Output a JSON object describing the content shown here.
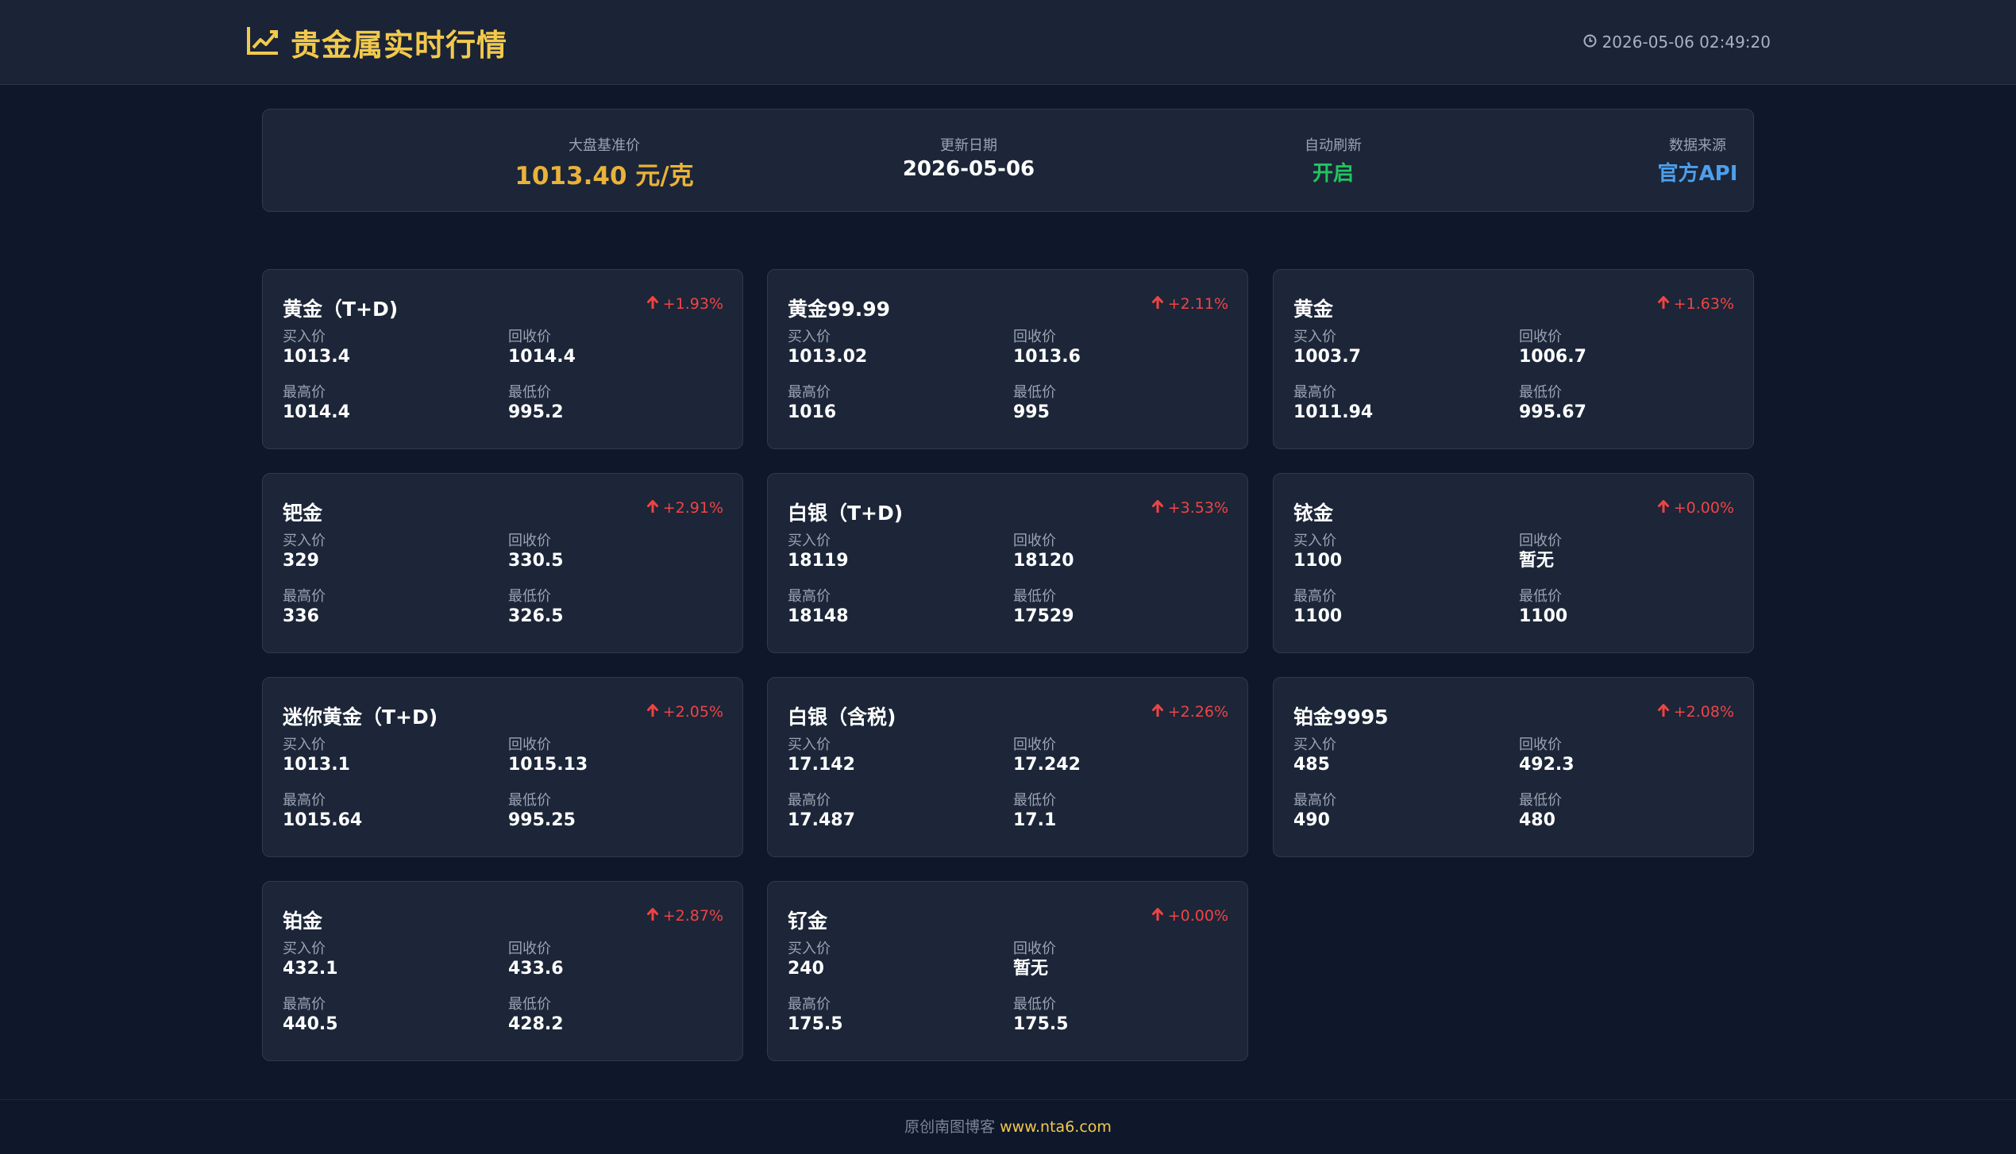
{
  "header": {
    "title": "贵金属实时行情",
    "datetime": "2026-05-06 02:49:20"
  },
  "stats": [
    {
      "label": "大盘基准价",
      "value": "1013.40 元/克",
      "color": "#eab23a"
    },
    {
      "label": "更新日期",
      "value": "2026-05-06",
      "color": "#ffffff"
    },
    {
      "label": "自动刷新",
      "value": "开启",
      "color": "#22c55e"
    },
    {
      "label": "数据来源",
      "value": "官方API",
      "color": "#4d9fec"
    }
  ],
  "field_labels": {
    "buy": "买入价",
    "recycle": "回收价",
    "high": "最高价",
    "low": "最低价"
  },
  "cards": [
    {
      "name": "黄金（T+D)",
      "change": "+1.93%",
      "buy": "1013.4",
      "recycle": "1014.4",
      "high": "1014.4",
      "low": "995.2"
    },
    {
      "name": "黄金99.99",
      "change": "+2.11%",
      "buy": "1013.02",
      "recycle": "1013.6",
      "high": "1016",
      "low": "995"
    },
    {
      "name": "黄金",
      "change": "+1.63%",
      "buy": "1003.7",
      "recycle": "1006.7",
      "high": "1011.94",
      "low": "995.67"
    },
    {
      "name": "钯金",
      "change": "+2.91%",
      "buy": "329",
      "recycle": "330.5",
      "high": "336",
      "low": "326.5"
    },
    {
      "name": "白银（T+D)",
      "change": "+3.53%",
      "buy": "18119",
      "recycle": "18120",
      "high": "18148",
      "low": "17529"
    },
    {
      "name": "铱金",
      "change": "+0.00%",
      "buy": "1100",
      "recycle": "暂无",
      "high": "1100",
      "low": "1100"
    },
    {
      "name": "迷你黄金（T+D)",
      "change": "+2.05%",
      "buy": "1013.1",
      "recycle": "1015.13",
      "high": "1015.64",
      "low": "995.25"
    },
    {
      "name": "白银（含税)",
      "change": "+2.26%",
      "buy": "17.142",
      "recycle": "17.242",
      "high": "17.487",
      "low": "17.1"
    },
    {
      "name": "铂金9995",
      "change": "+2.08%",
      "buy": "485",
      "recycle": "492.3",
      "high": "490",
      "low": "480"
    },
    {
      "name": "铂金",
      "change": "+2.87%",
      "buy": "432.1",
      "recycle": "433.6",
      "high": "440.5",
      "low": "428.2"
    },
    {
      "name": "钌金",
      "change": "+0.00%",
      "buy": "240",
      "recycle": "暂无",
      "high": "175.5",
      "low": "175.5"
    }
  ],
  "footer": {
    "text": "原创南图博客",
    "link": "www.nta6.com"
  },
  "colors": {
    "accent": "#f2c94c",
    "up": "#ef4444",
    "background": "#0f172a",
    "card": "#1c2638"
  },
  "icons": {
    "brand": "chart-line-icon",
    "clock": "clock-icon",
    "change": "arrow-up-icon"
  }
}
